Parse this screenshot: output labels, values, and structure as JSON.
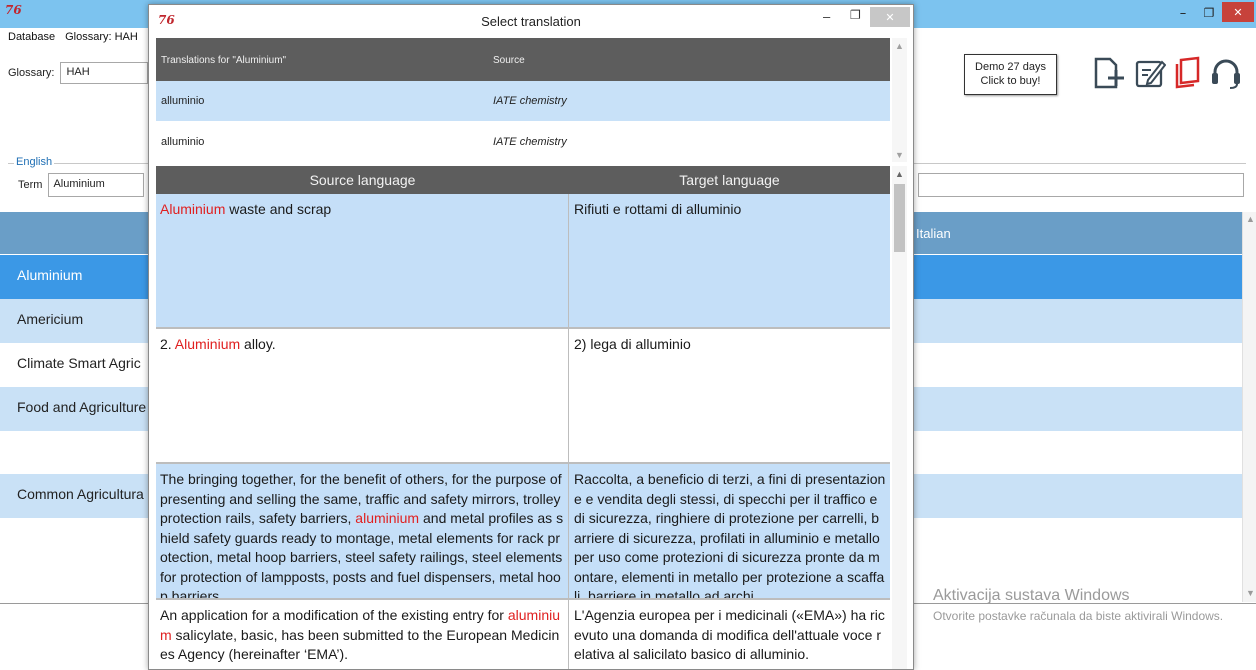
{
  "main_window": {
    "logo": "76",
    "controls": {
      "minimize": "–",
      "maximize": "❐",
      "close": "✕"
    },
    "menu": [
      "Database",
      "Glossary: HAH"
    ],
    "glossary_label": "Glossary:",
    "glossary_value": "HAH",
    "demo_badge": {
      "line1": "Demo 27 days",
      "line2": "Click to buy!"
    },
    "toolbar_icons": [
      "add-entry-icon",
      "edit-entry-icon",
      "book-icon",
      "headset-support-icon"
    ],
    "language_group": "English",
    "term_label": "Term",
    "term_value": "Aluminium",
    "grid_header_right": "Italian",
    "grid_rows": [
      "Aluminium",
      "Americium",
      "Climate Smart Agric",
      "Food and Agriculture",
      "",
      "Common Agricultura"
    ]
  },
  "activation": {
    "title": "Aktivacija sustava Windows",
    "text": "Otvorite postavke računala da biste aktivirali Windows."
  },
  "dialog": {
    "logo": "76",
    "title": "Select translation",
    "controls": {
      "minimize": "–",
      "maximize": "❐",
      "close": "✕"
    },
    "translations": {
      "headers": [
        "Translations for \"Aluminium\"",
        "Source"
      ],
      "rows": [
        {
          "term": "alluminio",
          "source": "IATE chemistry"
        },
        {
          "term": "alluminio",
          "source": "IATE chemistry"
        }
      ]
    },
    "context": {
      "headers": [
        "Source language",
        "Target language"
      ],
      "rows": [
        {
          "src_pre": "",
          "src_hl": "Aluminium",
          "src_post": " waste and scrap",
          "tgt": "Rifiuti e rottami di alluminio"
        },
        {
          "src_pre": "2. ",
          "src_hl": "Aluminium",
          "src_post": " alloy.",
          "tgt": "2) lega di alluminio"
        },
        {
          "src_pre": "The bringing together, for the benefit of others, for the purpose of presenting and selling the same, traffic and safety mirrors, trolley protection rails, safety barriers, ",
          "src_hl": "aluminium",
          "src_post": " and metal profiles as shield safety guards ready to montage, metal elements for rack protection, metal hoop barriers, steel safety railings, steel elements for protection of lampposts, posts and fuel dispensers, metal hoop barriers",
          "tgt": "Raccolta, a beneficio di terzi, a fini di presentazione e vendita degli stessi, di specchi per il traffico e di sicurezza, ringhiere di protezione per carrelli, barriere di sicurezza, profilati in alluminio e metallo per uso come protezioni di sicurezza pronte da montare, elementi in metallo per protezione a scaffali, barriere in metallo ad archi"
        },
        {
          "src_pre": "An application for a modification of the existing entry for ",
          "src_hl": "aluminium",
          "src_post": " salicylate, basic, has been submitted to the European Medicines Agency (hereinafter ‘EMA’).",
          "tgt": "L'Agenzia europea per i medicinali («EMA») ha ricevuto una domanda di modifica dell'attuale voce relativa al salicilato basico di alluminio."
        }
      ]
    }
  }
}
